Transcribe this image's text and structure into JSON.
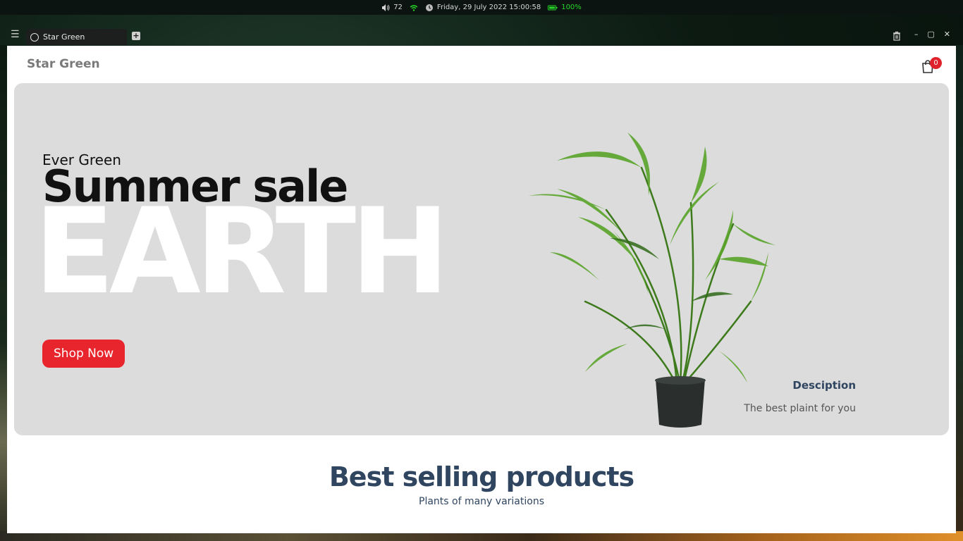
{
  "system_bar": {
    "volume": "72",
    "datetime": "Friday, 29 July 2022 15:00:58",
    "battery": "100%"
  },
  "browser": {
    "tab_title": "Star Green"
  },
  "page": {
    "brand": "Star Green",
    "cart_count": "0",
    "hero": {
      "kicker": "Ever Green",
      "headline": "Summer sale",
      "background_word": "EARTH",
      "cta_label": "Shop Now",
      "description_title": "Desciption",
      "description_text": "The best plaint for you"
    },
    "section": {
      "title": "Best selling products",
      "subtitle": "Plants of many variations"
    }
  },
  "colors": {
    "accent_red": "#e8252d",
    "heading_navy": "#2f4560",
    "hero_bg": "#dcdcdc",
    "battery_green": "#27d827"
  }
}
